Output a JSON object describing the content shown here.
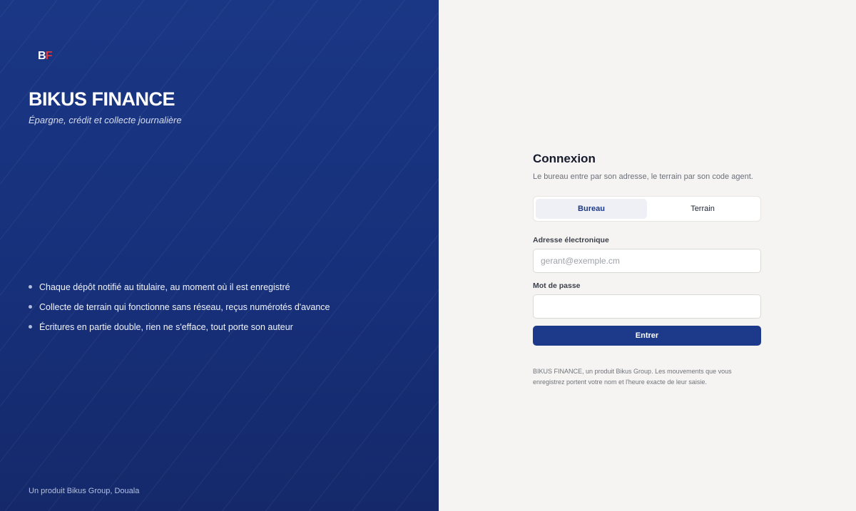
{
  "brand": {
    "logo_b": "B",
    "logo_f": "F",
    "title": "BIKUS FINANCE",
    "tagline": "Épargne, crédit et collecte journalière",
    "features": [
      "Chaque dépôt notifié au titulaire, au moment où il est enregistré",
      "Collecte de terrain qui fonctionne sans réseau, reçus numérotés d'avance",
      "Écritures en partie double, rien ne s'efface, tout porte son auteur"
    ],
    "footer": "Un produit Bikus Group, Douala"
  },
  "login": {
    "title": "Connexion",
    "subtitle": "Le bureau entre par son adresse, le terrain par son code agent.",
    "tabs": [
      {
        "label": "Bureau",
        "active": true
      },
      {
        "label": "Terrain",
        "active": false
      }
    ],
    "email_label": "Adresse électronique",
    "email_placeholder": "gerant@exemple.cm",
    "email_value": "",
    "password_label": "Mot de passe",
    "password_value": "",
    "submit_label": "Entrer",
    "legal_note": "BIKUS FINANCE, un produit Bikus Group. Les mouvements que vous enregistrez portent votre nom et l'heure exacte de leur saisie."
  },
  "colors": {
    "brand_blue": "#1a3785",
    "button_blue": "#1d3a8a",
    "logo_red": "#e23a3a",
    "login_background": "#f5f4f2"
  }
}
